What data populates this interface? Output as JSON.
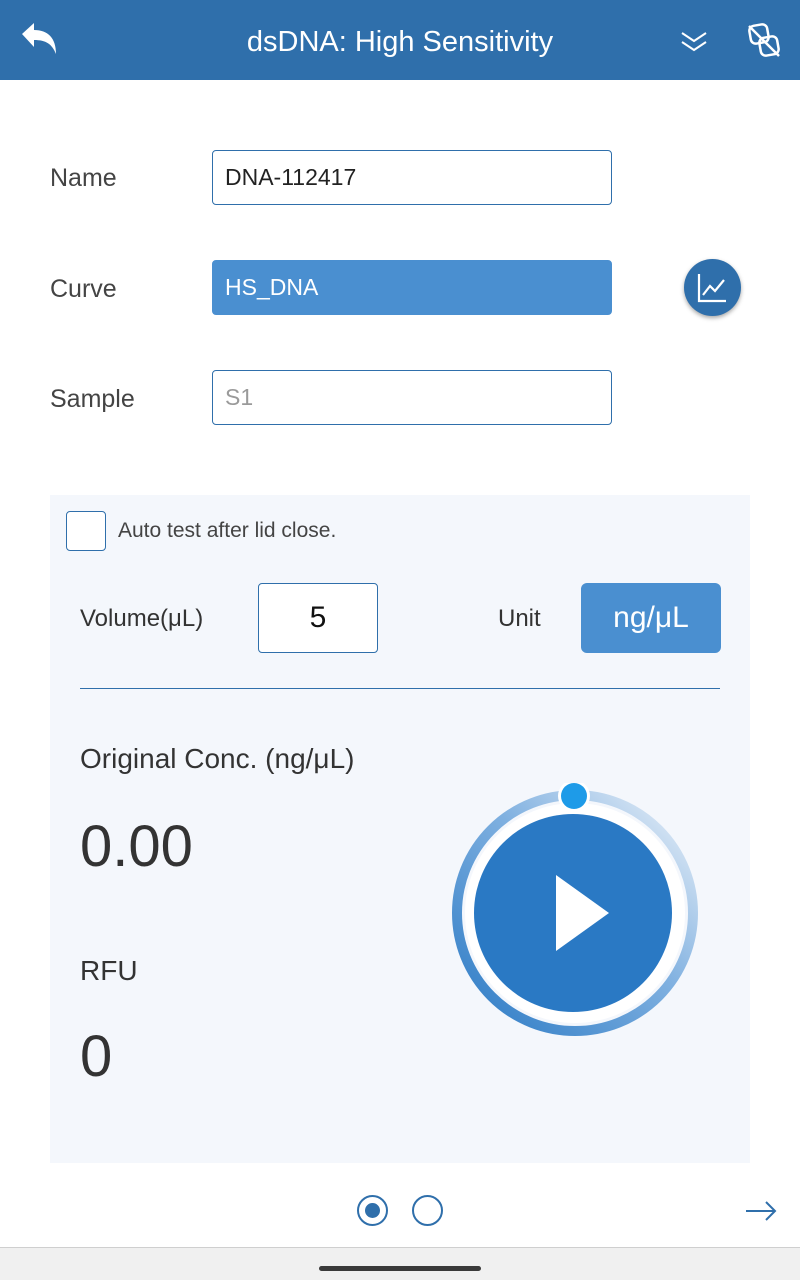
{
  "header": {
    "title": "dsDNA: High Sensitivity",
    "back_icon": "back-arrow-icon",
    "menu_icon": "double-chevron-down-icon",
    "action_icon": "unlink-icon"
  },
  "form": {
    "name_label": "Name",
    "name_value": "DNA-112417",
    "curve_label": "Curve",
    "curve_value": "HS_DNA",
    "sample_label": "Sample",
    "sample_placeholder": "S1"
  },
  "panel": {
    "auto_test_label": "Auto test after lid close.",
    "auto_test_checked": false,
    "volume_label": "Volume(μL)",
    "volume_value": "5",
    "unit_label": "Unit",
    "unit_value": "ng/μL",
    "conc_label": "Original Conc. (ng/μL)",
    "conc_value": "0.00",
    "rfu_label": "RFU",
    "rfu_value": "0"
  },
  "pager": {
    "pages": 2,
    "active_page": 1
  },
  "colors": {
    "primary": "#2f6fab",
    "accent": "#4a8fd0",
    "play": "#2a79c4",
    "knob": "#1e9be8",
    "panel_bg": "#f4f7fc"
  }
}
